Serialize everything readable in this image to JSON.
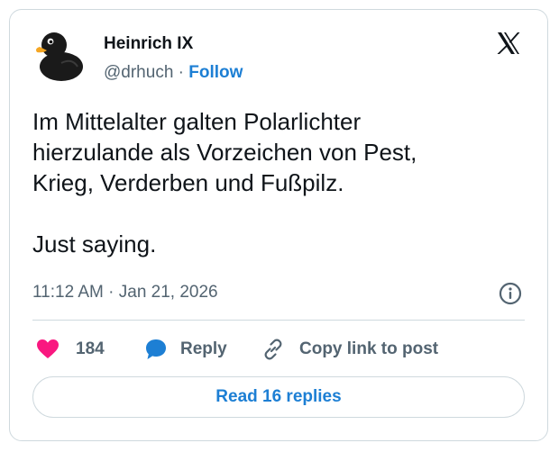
{
  "author": {
    "name": "Heinrich IX",
    "handle": "@drhuch",
    "separator": "·",
    "follow_label": "Follow",
    "avatar_icon": "rubber-duck-avatar"
  },
  "platform_icon": "x-logo-icon",
  "tweet": {
    "lines": [
      "Im Mittelalter galten Polarlichter",
      "hierzulande als Vorzeichen von Pest,",
      "Krieg, Verderben und Fußpilz."
    ],
    "closing": "Just saying.",
    "timestamp": "11:12 AM · Jan 21, 2026"
  },
  "actions": {
    "like_count": "184",
    "reply_label": "Reply",
    "copy_label": "Copy link to post"
  },
  "read_replies_label": "Read 16 replies",
  "colors": {
    "accent": "#1d7fd4",
    "like": "#f91880",
    "muted": "#536471",
    "border": "#cfd9de"
  }
}
